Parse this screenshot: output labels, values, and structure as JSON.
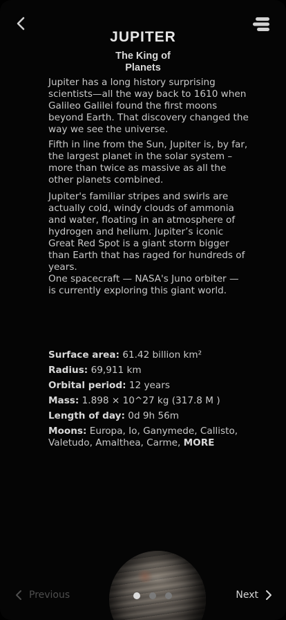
{
  "header": {
    "title": "JUPITER",
    "subtitle": "The King of Planets",
    "back_icon": "chevron-left-icon",
    "menu_icon": "menu-icon"
  },
  "body": {
    "paragraphs": [
      "Jupiter has a long history surprising scientists—all the way back to 1610 when Galileo Galilei found the first moons beyond Earth. That discovery changed the way we see the universe.",
      "Fifth in line from the Sun, Jupiter is, by far, the largest planet in the solar system – more than twice as massive as all the other planets combined.",
      "Jupiter's familiar stripes and swirls are actually cold, windy clouds of ammonia and water, floating in an atmosphere of hydrogen and helium. Jupiter’s iconic Great Red Spot is a giant storm bigger than Earth that has raged for hundreds of years.",
      "One spacecraft — NASA's Juno orbiter — is currently exploring this giant world."
    ]
  },
  "facts": {
    "surface_area": {
      "label": "Surface area:",
      "value": "61.42 billion km²"
    },
    "radius": {
      "label": "Radius:",
      "value": "69,911 km"
    },
    "orbital_period": {
      "label": "Orbital period:",
      "value": "12 years"
    },
    "mass": {
      "label": "Mass:",
      "value": "1.898 × 10^27 kg (317.8 M  )"
    },
    "length_of_day": {
      "label": "Length of day:",
      "value": "0d 9h 56m"
    },
    "moons": {
      "label": "Moons:",
      "value": "Europa, Io, Ganymede, Callisto, Valetudo, Amalthea, Carme,",
      "more": "MORE"
    }
  },
  "footer": {
    "previous_label": "Previous",
    "next_label": "Next",
    "page_count": 3,
    "active_page": 1
  },
  "colors": {
    "background": "#050505",
    "text": "#c9c9c9",
    "disabled": "#4e4e4e",
    "dot_active": "#dcdcdc",
    "dot_inactive": "#7a7a7a"
  }
}
